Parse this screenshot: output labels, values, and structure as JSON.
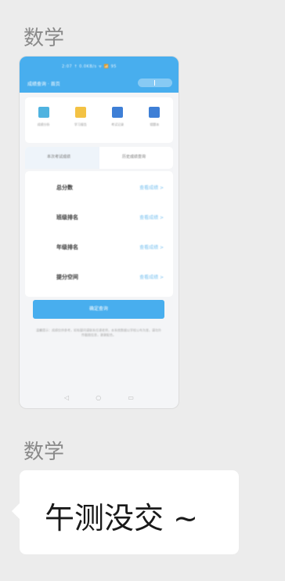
{
  "messages": [
    {
      "sender": "数学",
      "type": "image",
      "thumbnail": {
        "status_text": "2:07 ↑ 0.0KB/s ᯤ 📶 95",
        "nav_title": "成绩查询 · 首页",
        "icons": [
          {
            "label": "成绩分析",
            "color": "#4fb3e0",
            "name": "chart-icon"
          },
          {
            "label": "学习报告",
            "color": "#f3c244",
            "name": "report-icon"
          },
          {
            "label": "考试记录",
            "color": "#3e7fd6",
            "name": "calendar-icon"
          },
          {
            "label": "错题本",
            "color": "#3e7fd6",
            "name": "notebook-icon"
          }
        ],
        "tabs": [
          "本次考试成绩",
          "历史成绩查询"
        ],
        "rows": [
          {
            "label": "总分数",
            "value": "查看成绩 >"
          },
          {
            "label": "班级排名",
            "value": "查看成绩 >"
          },
          {
            "label": "年级排名",
            "value": "查看成绩 >"
          },
          {
            "label": "提分空间",
            "value": "查看成绩 >"
          }
        ],
        "button_label": "确定查询",
        "note": "温馨提示：成绩仅供参考，如有疑问请联系任课老师，本系统数据以学校公布为准，请勿外传截图信息，谢谢配合。",
        "sys_nav": [
          "◁",
          "○",
          "▭"
        ]
      }
    },
    {
      "sender": "数学",
      "type": "text",
      "text": "午测没交 ~"
    }
  ],
  "colors": {
    "background": "#ececec",
    "accent": "#48aeee",
    "bubble": "#ffffff"
  }
}
